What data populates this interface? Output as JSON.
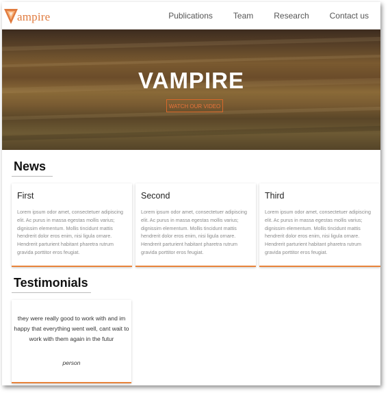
{
  "brand": {
    "name": "Vampire",
    "text": "ampire",
    "color": "#e07b3f"
  },
  "nav": {
    "items": [
      "Publications",
      "Team",
      "Research",
      "Contact us"
    ]
  },
  "hero": {
    "title": "VAMPIRE",
    "button_label": "WATCH OUR VIDEO",
    "accent": "#d9682a"
  },
  "news": {
    "heading": "News",
    "cards": [
      {
        "title": "First",
        "body": "Lorem ipsum odor amet, consectetuer adipiscing elit. Ac purus in massa egestas mollis varius; dignissim elementum. Mollis tincidunt mattis hendrerit dolor eros enim, nisi ligula ornare. Hendrerit parturient habitant pharetra rutrum gravida porttitor eros feugiat."
      },
      {
        "title": "Second",
        "body": "Lorem ipsum odor amet, consectetuer adipiscing elit. Ac purus in massa egestas mollis varius; dignissim elementum. Mollis tincidunt mattis hendrerit dolor eros enim, nisi ligula ornare. Hendrerit parturient habitant pharetra rutrum gravida porttitor eros feugiat."
      },
      {
        "title": "Third",
        "body": "Lorem ipsum odor amet, consectetuer adipiscing elit. Ac purus in massa egestas mollis varius; dignissim elementum. Mollis tincidunt mattis hendrerit dolor eros enim, nisi ligula ornare. Hendrerit parturient habitant pharetra rutrum gravida porttitor eros feugiat."
      }
    ]
  },
  "testimonials": {
    "heading": "Testimonials",
    "items": [
      {
        "quote": "they were really good to work with and im happy that everything went well, cant wait to work with them again in the futur",
        "author": "person"
      }
    ]
  }
}
